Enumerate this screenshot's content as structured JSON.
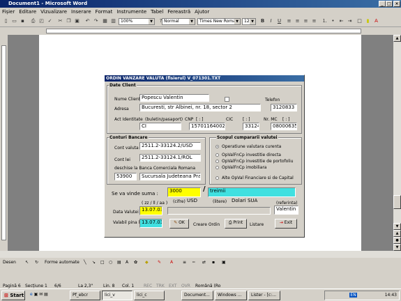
{
  "window": {
    "title": "Document1 - Microsoft Word"
  },
  "menu": [
    "Fișier",
    "Editare",
    "Vizualizare",
    "Inserare",
    "Format",
    "Instrumente",
    "Tabel",
    "Fereastră",
    "Ajutor"
  ],
  "toolbar": {
    "zoom": "100%",
    "style": "Normal",
    "font": "Times New Roman",
    "size": "12"
  },
  "dialog": {
    "title": "ORDIN VANZARE VALUTA   (fisierul) V_071301.TXT",
    "client": {
      "group": "Date Client",
      "name_label": "Nume Client",
      "name_value": "Popescu Valentin",
      "phone_label": "Telefon",
      "phone_value": "3120833",
      "address_label": "Adresa",
      "address_value": "Bucuresti, str Albinei, nr. 18, sector 2",
      "id_label": "Act  Identitate",
      "id_hint": "(buletin/pasaport)",
      "id_value": "CI",
      "cnp_label": "CNP",
      "cnp_bracket": "[ : ]",
      "cnp_value": "1570116400224",
      "cic_label": "CIC",
      "cic_bracket": "[ : ]",
      "cic_value": "33124",
      "mc_label": "Nr. MC",
      "mc_bracket": "[ : ]",
      "mc_value": "08000635"
    },
    "bank": {
      "group": "Conturi Bancare",
      "fx_label": "Cont valuta",
      "fx_value": "2511.2-33124.2/USD",
      "lei_label": "Cont lei",
      "lei_value": "2511.2-33124.1/ROL",
      "opened_label": "deschise la Banca Comerciala Romana",
      "branch_code": "53900",
      "branch_name": "Sucursala Judeteana Pra"
    },
    "purpose": {
      "group": "Scopul cumpararii valutei",
      "options": [
        "Operatiune valutara curenta",
        "OpValFnCp investitie directa",
        "OpValFnCp investitie de portofoliu",
        "OpValFnCp imobiliara",
        "Alte OpVal Financiare si de Capital"
      ]
    },
    "sale": {
      "label": "Se va vinde suma :",
      "amount": "3000",
      "digits_hint": "(cifre)",
      "currency": "USD",
      "words": "treimii",
      "letters_hint": "(litere)",
      "words_currency": "Dolari SUA",
      "ref_hint": "(referinta)",
      "ref_value": "Valentin",
      "date_hint": "( zz / ll / aa )",
      "date_label": "Data Valutei",
      "date_value": "13.07.03",
      "valid_label": "Valabil pina la",
      "valid_value": "13.07.03"
    },
    "buttons": {
      "ok": "OK",
      "create": "Creare Ordin",
      "print": "Print",
      "list": "Listare",
      "exit": "Exit"
    }
  },
  "drawbar": {
    "draw": "Desen",
    "autoshapes": "Forme automate"
  },
  "status": {
    "page": "Pagină 6",
    "section": "Secțiune 1",
    "pages": "6/6",
    "at": "La 2,3\"",
    "line": "Lin. 8",
    "col": "Col. 1",
    "rec": "REC",
    "trk": "TRK",
    "ext": "EXT",
    "ovr": "OVR",
    "lang": "Română (Ro"
  },
  "taskbar": {
    "start": "Start",
    "tasks": [
      "Pf_ebcr",
      "lici_v",
      "lici_c",
      "Document...",
      "Windows ...",
      "Lister - [c:..."
    ],
    "lang": "EN",
    "clock": "14:43"
  }
}
